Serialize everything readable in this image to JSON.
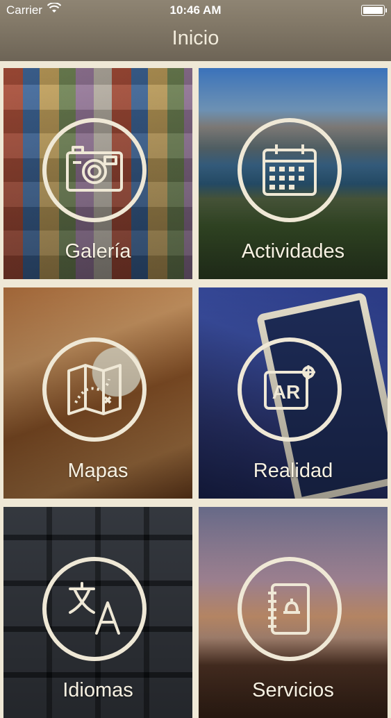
{
  "status_bar": {
    "carrier": "Carrier",
    "time": "10:46 AM",
    "wifi_icon": "wifi-icon",
    "battery_icon": "battery-icon"
  },
  "nav": {
    "title": "Inicio"
  },
  "tiles": [
    {
      "label": "Galería",
      "icon": "camera-gallery-icon"
    },
    {
      "label": "Actividades",
      "icon": "calendar-icon"
    },
    {
      "label": "Mapas",
      "icon": "map-icon"
    },
    {
      "label": "Realidad",
      "icon": "ar-icon"
    },
    {
      "label": "Idiomas",
      "icon": "translate-icon"
    },
    {
      "label": "Servicios",
      "icon": "services-notebook-icon"
    }
  ],
  "colors": {
    "ring": "#efe8d6",
    "label": "#f7f1e2",
    "nav_bg": "#7a7060",
    "background": "#efe8d6"
  }
}
